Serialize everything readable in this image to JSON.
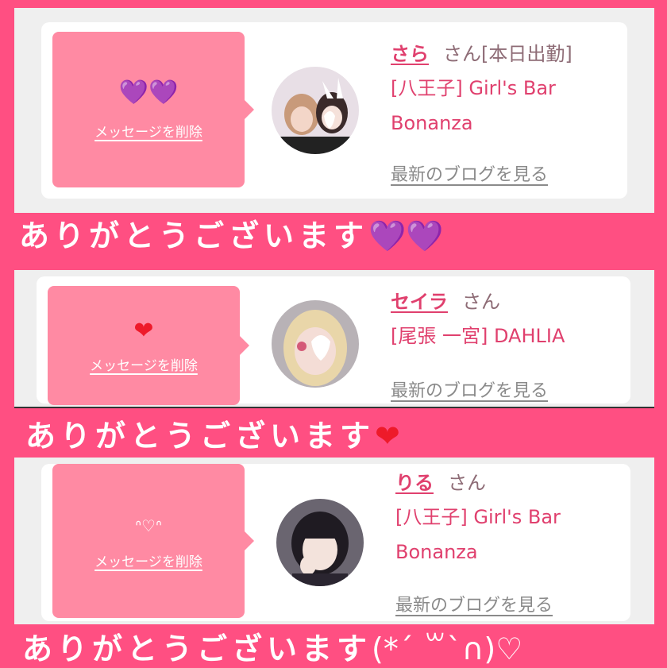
{
  "colors": {
    "background": "#ff4f82",
    "accent": "#e0406e",
    "bubble": "#ff8aa3",
    "purple_heart": "#7a1fa8",
    "red_heart": "#ee1a2a"
  },
  "entries": [
    {
      "bubble_emoji": "💜💜",
      "delete_label": "メッセージを削除",
      "name": "さら",
      "suffix": "さん",
      "status": "[本日出勤]",
      "shop_line1": "[八王子] Girl's Bar",
      "shop_line2": "Bonanza",
      "blog_label": "最新のブログを見る",
      "thanks_text": "ありがとうございます",
      "thanks_deco": "💜💜"
    },
    {
      "bubble_emoji": "❤",
      "delete_label": "メッセージを削除",
      "name": "セイラ",
      "suffix": "さん",
      "status": "",
      "shop_line1": "[尾張 一宮] DAHLIA",
      "shop_line2": "",
      "blog_label": "最新のブログを見る",
      "thanks_text": "ありがとうございます",
      "thanks_deco": "❤"
    },
    {
      "bubble_emoji": "ᐢ♡ᐢ",
      "delete_label": "メッセージを削除",
      "name": "りる",
      "suffix": "さん",
      "status": "",
      "shop_line1": "[八王子] Girl's Bar",
      "shop_line2": "Bonanza",
      "blog_label": "最新のブログを見る",
      "thanks_text": "ありがとうございます",
      "thanks_deco": "(*´ ꒳`∩)♡"
    }
  ]
}
